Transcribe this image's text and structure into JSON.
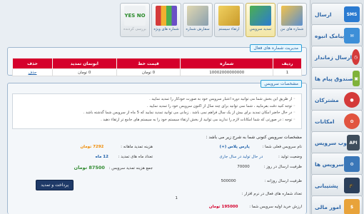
{
  "sidebar": {
    "items": [
      {
        "label": "ارسال",
        "icon": "sms-icon",
        "icon_text": "SMS",
        "color": "#2b7bd1"
      },
      {
        "label": "پیامک انبوه",
        "icon": "bulk-sms-icon",
        "icon_text": "",
        "color": "#3d8fd8"
      },
      {
        "label": "ارسال زماندار",
        "icon": "clock-icon",
        "icon_text": "",
        "color": "#d43a3a"
      },
      {
        "label": "صندوق پیام ها",
        "icon": "inbox-icon",
        "icon_text": "",
        "color": "#7fb23a"
      },
      {
        "label": "مشترکان",
        "icon": "contacts-icon",
        "icon_text": "",
        "color": "#d43a3a"
      },
      {
        "label": "امکانات",
        "icon": "features-icon",
        "icon_text": "",
        "color": "#e1543f"
      },
      {
        "label": "وب سرویس",
        "icon": "api-icon",
        "icon_text": "API",
        "color": "#3e4d5c"
      },
      {
        "label": "سرویس ها",
        "icon": "services-icon",
        "icon_text": "",
        "color": "#3a77b8"
      },
      {
        "label": "پشتیبانی",
        "icon": "support-icon",
        "icon_text": "",
        "color": "#2b3f5a"
      },
      {
        "label": "امور مالی",
        "icon": "finance-icon",
        "icon_text": "",
        "color": "#e8a33a"
      }
    ]
  },
  "toolbar": {
    "items": [
      {
        "label": "شماره های من",
        "icon": "my-numbers-icon",
        "color": "#5a8fd0",
        "active": false
      },
      {
        "label": "تمدید سرویس",
        "icon": "renew-service-icon",
        "color": "#4caf50",
        "active": true
      },
      {
        "label": "ارتقاء سیستم",
        "icon": "upgrade-icon",
        "color": "#d9b43a",
        "active": false
      },
      {
        "label": "سفارش شماره",
        "icon": "order-number-icon",
        "color": "#8aa0b0",
        "active": false
      },
      {
        "label": "شماره های ویژه",
        "icon": "special-numbers-icon",
        "color": "#c64fa0",
        "active": false
      },
      {
        "label": "بررسی کردنده",
        "icon": "check-icon",
        "color": "#9aa2aa",
        "active": false,
        "disabled": true,
        "badge": "YES NO"
      }
    ]
  },
  "numbers_panel": {
    "title": "مدیریت شماره های فعال",
    "headers": [
      "ردیف",
      "شماره",
      "قیمت خط",
      "ابونمان تمدید",
      "حذف"
    ],
    "rows": [
      {
        "index": "1",
        "number": "10002000000000",
        "line_price": "0 تومان",
        "renewal": "0 تومان",
        "delete": "حذف"
      }
    ]
  },
  "services_panel": {
    "title": "مشخصات سرویس",
    "notes": [
      "از طریق این بخش شما می توانید دوره اعتبار سرویس خود به صورت خودکار را تمدید نمایید .",
      "توجه کنید دقت بفرمایید ، شما نمی توانید برای چند سال از اکنون سرویس خود را تمدید نمایید .",
      "در حال حاضر امکان تمدید برای بیش از یک سال فراهم نمی باشد . زمانی می توانید تمدید نمایید که 5 ماه از سرویس شما گذشته باشد .",
      "توجه : در صورتی که شما امکانات لازم را ندارید می توانید از بخش ارتقاء سیستم خود را به سیستم های جامع تر ارتقاء دهید ."
    ],
    "info_title": "مشخصات سرویس کنونی شما به شرح زیر می باشد :",
    "plan_name_label": "نام سرویس فعلی شما :",
    "plan_name": "پارس پلاس (+)",
    "monthly_fee_label": "هزینه تمدید ماهانه :",
    "monthly_fee": "7292 تومان",
    "status_label": "وضعیت تولید :",
    "status_value": "در حال تولید در سال جاری",
    "months_label": "تعداد ماه های تمدید :",
    "months_value": "12 ماه",
    "capacity_label": "ظرفیت ارسال در روز :",
    "capacity_value": "70000",
    "total_label": "جمع هزینه تمدید سرویس :",
    "total_value": "87500 تومان",
    "pay_button": "پرداخت و تمدید",
    "daily_label": "ظرفیت ارسال روزانه :",
    "daily_value": "500000",
    "active_count_label": "تعداد شماره های فعال در نرم افزار :",
    "active_count": "1",
    "cost_label": "ارزش خرید اولیه سرویس شما :",
    "cost_value": "195000 تومان"
  }
}
